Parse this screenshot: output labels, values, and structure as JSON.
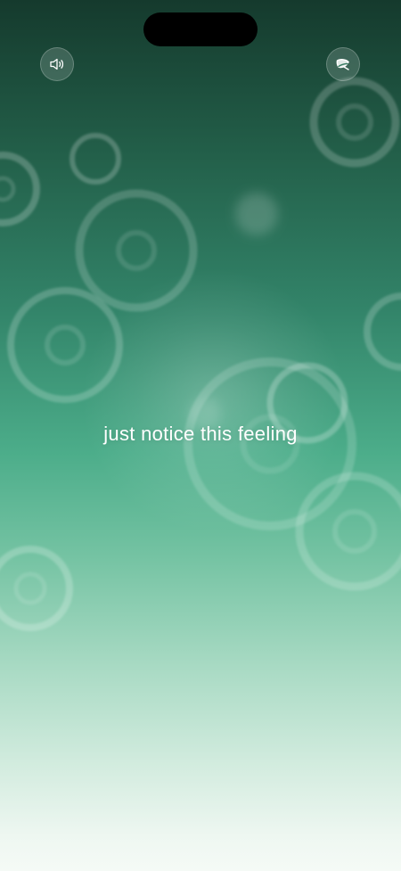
{
  "screen": {
    "prompt_text": "just notice this feeling"
  },
  "controls": {
    "sound_button_icon": "speaker-icon",
    "leaf_button_icon": "leaf-icon"
  },
  "colors": {
    "gradient_top": "#153a2d",
    "gradient_mid": "#4cad8a",
    "gradient_bottom": "#f5faf6",
    "text": "#ffffff"
  }
}
